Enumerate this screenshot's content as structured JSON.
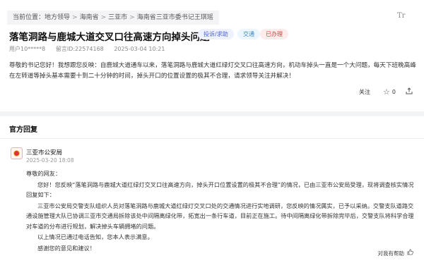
{
  "breadcrumb": {
    "label": "当前位置：",
    "items": [
      "地方领导",
      "海南省",
      "三亚市",
      "海南省三亚市委书记王琪瑶"
    ],
    "separator": ">"
  },
  "font_size_icon": "Tr",
  "post": {
    "title": "落笔洞路与鹿城大道交叉口往高速方向掉头问题",
    "tags": {
      "type": "投诉/求助",
      "category": "交通",
      "status": "已办理"
    },
    "user": "用户10*****8",
    "id_text": "留言ID:22574168",
    "date": "2025-03-04 10:21",
    "greeting": "尊敬的书记您好！我想跟您反映：",
    "body": "自鹿城大道通车以来，落笔洞路与鹿城大道红绿灯交叉口往高速方向，机动车掉头一直是一个大问题，每天下班晚高峰在左转道等掉头基本需要十到二十分钟的时间，掉头开口的位置设置的极其不合理，请求领导关注并解决！",
    "follow_label": "关注",
    "star_count": "0"
  },
  "official": {
    "section_title": "官方回复",
    "org": "三亚市公安局",
    "time": "2025-03-20 18:08",
    "salutation": "尊敬的网友：",
    "p1": "您好！您反映“落笔洞路与鹿城大道红绿灯交叉口往高速方向，掉头开口位置设置的极其不合理”的情况，已由三亚市公安局受理，现将调查核实情况回复如下：",
    "p2": "三亚市公安局交警支队组织人员对落笔洞路与鹿城大道红绿灯交叉口处的交通情况进行实地调研，您反映的情况属实，已予以采纳。交警支队道路交通设施管理大队已协调三亚市交通局拆除该处中间隔离绿化带，拓宽出一条行车道，目前正在施工。待中间隔离绿化带拆除完毕后，交警支队将科学合理对车道的分布进行规划，解决掉头车辆拥堵的问题。",
    "p3": "以上情况已通过电话告知，您本人表示满意。",
    "p4": "感谢您的意见和建议！",
    "helpful_label": "对我有帮助"
  }
}
